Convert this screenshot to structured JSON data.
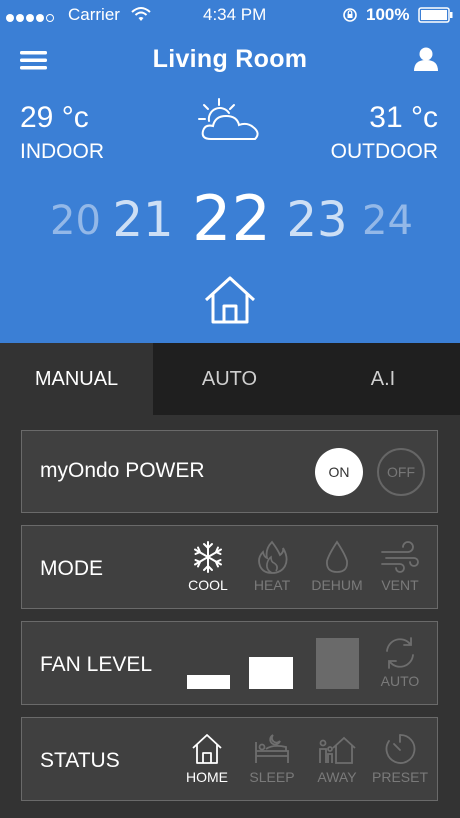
{
  "status_bar": {
    "carrier": "Carrier",
    "time": "4:34 PM",
    "battery": "100%"
  },
  "header": {
    "title": "Living Room",
    "menu_icon": "hamburger-menu-icon",
    "user_icon": "user-icon"
  },
  "weather": {
    "indoor": {
      "value": "29",
      "unit": "°c",
      "label": "INDOOR"
    },
    "outdoor": {
      "value": "31",
      "unit": "°c",
      "label": "OUTDOOR"
    },
    "icon": "partly-cloudy-icon"
  },
  "setpoints": [
    "20",
    "21",
    "22",
    "23",
    "24"
  ],
  "selected_setpoint": "22",
  "home_icon": "home-icon",
  "tabs": [
    {
      "label": "MANUAL",
      "active": true
    },
    {
      "label": "AUTO",
      "active": false
    },
    {
      "label": "A.I",
      "active": false
    }
  ],
  "power": {
    "title": "myOndo POWER",
    "on_label": "ON",
    "off_label": "OFF",
    "state": "ON"
  },
  "mode": {
    "title": "MODE",
    "options": [
      {
        "label": "COOL",
        "icon": "snowflake-icon",
        "active": true
      },
      {
        "label": "HEAT",
        "icon": "flame-icon",
        "active": false
      },
      {
        "label": "DEHUM",
        "icon": "water-drop-icon",
        "active": false
      },
      {
        "label": "VENT",
        "icon": "wind-icon",
        "active": false
      }
    ]
  },
  "fan": {
    "title": "FAN LEVEL",
    "levels": [
      {
        "level": 1,
        "active": true
      },
      {
        "level": 2,
        "active": true
      },
      {
        "level": 3,
        "active": false
      }
    ],
    "auto_label": "AUTO",
    "auto_icon": "refresh-icon"
  },
  "status": {
    "title": "STATUS",
    "options": [
      {
        "label": "HOME",
        "icon": "home-icon",
        "active": true
      },
      {
        "label": "SLEEP",
        "icon": "bed-icon",
        "active": false
      },
      {
        "label": "AWAY",
        "icon": "away-family-icon",
        "active": false
      },
      {
        "label": "PRESET",
        "icon": "timer-icon",
        "active": false
      }
    ]
  },
  "colors": {
    "header_blue": "#3b7fd5",
    "background": "#333333",
    "panel": "#404040",
    "inactive": "#7a7a7a"
  }
}
